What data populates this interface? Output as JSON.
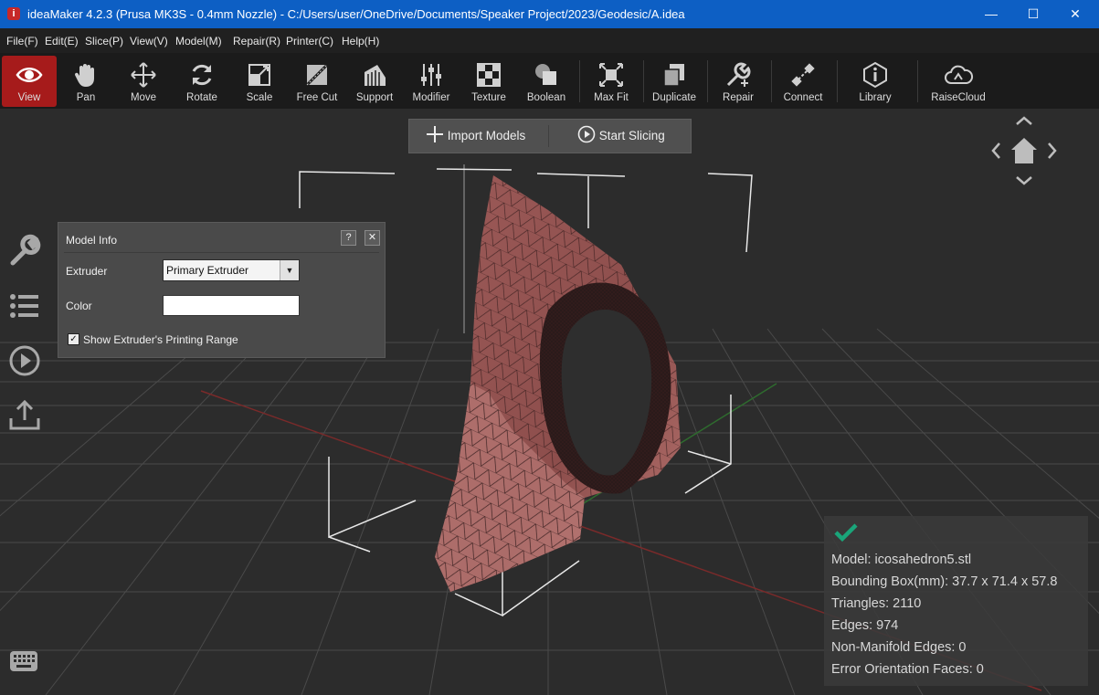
{
  "titlebar": {
    "app_icon": "i",
    "title": "ideaMaker 4.2.3 (Prusa MK3S - 0.4mm Nozzle) - C:/Users/user/OneDrive/Documents/Speaker Project/2023/Geodesic/A.idea",
    "minimize": "—",
    "maximize": "☐",
    "close": "✕"
  },
  "menu": [
    "File(F)",
    "Edit(E)",
    "Slice(P)",
    "View(V)",
    "Model(M)",
    "Repair(R)",
    "Printer(C)",
    "Help(H)"
  ],
  "toolbar": [
    {
      "label": "View",
      "icon": "eye-icon",
      "active": true
    },
    {
      "label": "Pan",
      "icon": "hand-icon"
    },
    {
      "label": "Move",
      "icon": "move-arrows-icon"
    },
    {
      "label": "Rotate",
      "icon": "rotate-icon"
    },
    {
      "label": "Scale",
      "icon": "scale-icon"
    },
    {
      "label": "Free Cut",
      "icon": "free-cut-icon"
    },
    {
      "label": "Support",
      "icon": "support-icon"
    },
    {
      "label": "Modifier",
      "icon": "modifier-sliders-icon"
    },
    {
      "label": "Texture",
      "icon": "texture-checker-icon"
    },
    {
      "label": "Boolean",
      "icon": "boolean-shapes-icon"
    },
    {
      "label": "Max Fit",
      "icon": "max-fit-icon"
    },
    {
      "label": "Duplicate",
      "icon": "duplicate-icon"
    },
    {
      "label": "Repair",
      "icon": "wrench-plus-icon"
    },
    {
      "label": "Connect",
      "icon": "connect-icon"
    },
    {
      "label": "Library",
      "icon": "library-info-icon"
    },
    {
      "label": "RaiseCloud",
      "icon": "cloud-icon"
    }
  ],
  "actions": {
    "import_label": "Import Models",
    "slice_label": "Start Slicing"
  },
  "panel": {
    "title": "Model Info",
    "help": "?",
    "close": "✕",
    "extruder_label": "Extruder",
    "extruder_value": "Primary Extruder",
    "color_label": "Color",
    "color_value": "#ffffff",
    "show_range_label": "Show Extruder's Printing Range",
    "show_range_checked": true
  },
  "info": {
    "status": "ok",
    "model": "Model: icosahedron5.stl",
    "bbox": "Bounding Box(mm): 37.7 x 71.4 x 57.8",
    "triangles": "Triangles: 2110",
    "edges": "Edges: 974",
    "non_manifold": "Non-Manifold Edges: 0",
    "error_faces": "Error Orientation Faces: 0"
  },
  "colors": {
    "accent_active": "#a61b1b",
    "titlebar": "#0d5fc4",
    "model": "#9a5856",
    "check": "#1aa57a"
  }
}
